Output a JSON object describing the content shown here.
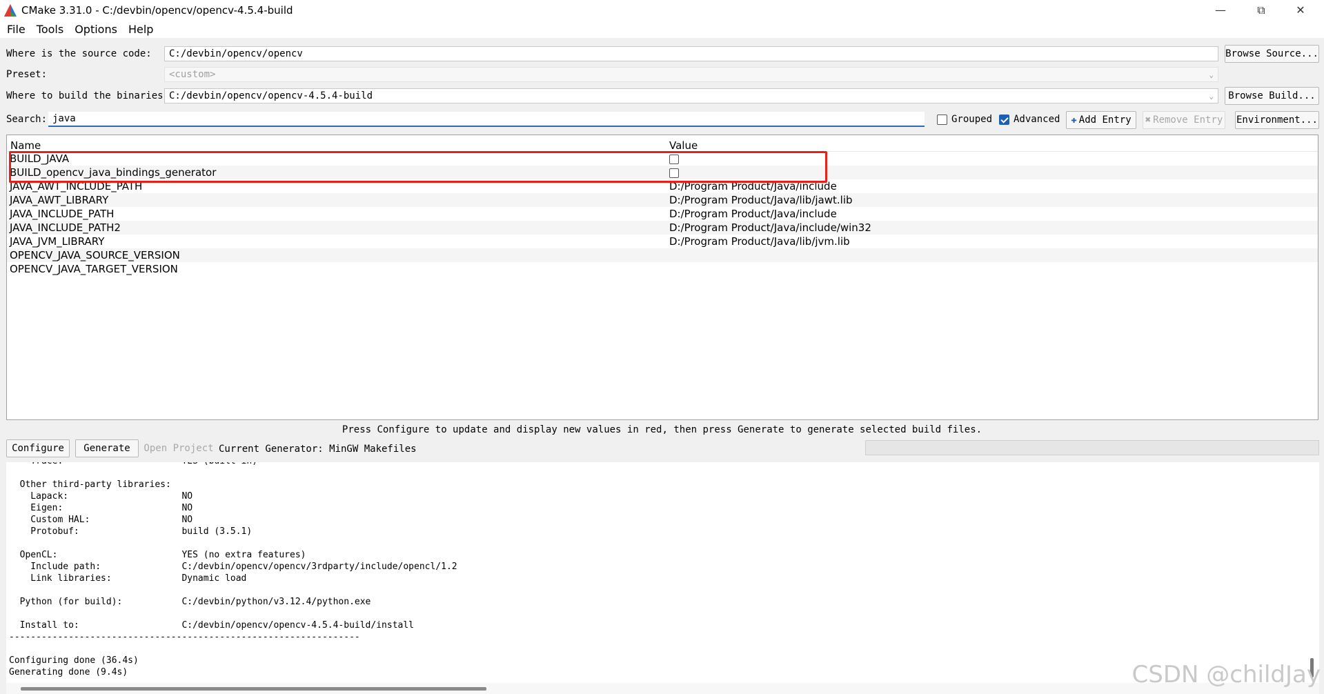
{
  "window": {
    "title": "CMake 3.31.0 - C:/devbin/opencv/opencv-4.5.4-build",
    "minimize": "—",
    "restore": "⧉",
    "close": "✕"
  },
  "menu": {
    "file": "File",
    "tools": "Tools",
    "options": "Options",
    "help": "Help"
  },
  "source": {
    "label": "Where is the source code:",
    "value": "C:/devbin/opencv/opencv",
    "browse": "Browse Source..."
  },
  "preset": {
    "label": "Preset:",
    "value": "<custom>"
  },
  "build": {
    "label": "Where to build the binaries:",
    "value": "C:/devbin/opencv/opencv-4.5.4-build",
    "browse": "Browse Build..."
  },
  "search": {
    "label": "Search:",
    "value": "java",
    "grouped_label": "Grouped",
    "grouped_checked": false,
    "advanced_label": "Advanced",
    "advanced_checked": true,
    "add_entry": "Add Entry",
    "remove_entry": "Remove Entry",
    "environment": "Environment..."
  },
  "table": {
    "col_name": "Name",
    "col_value": "Value",
    "rows": [
      {
        "name": "BUILD_JAVA",
        "value": "",
        "checkbox": true
      },
      {
        "name": "BUILD_opencv_java_bindings_generator",
        "value": "",
        "checkbox": true
      },
      {
        "name": "JAVA_AWT_INCLUDE_PATH",
        "value": "D:/Program Product/Java/include"
      },
      {
        "name": "JAVA_AWT_LIBRARY",
        "value": "D:/Program Product/Java/lib/jawt.lib"
      },
      {
        "name": "JAVA_INCLUDE_PATH",
        "value": "D:/Program Product/Java/include"
      },
      {
        "name": "JAVA_INCLUDE_PATH2",
        "value": "D:/Program Product/Java/include/win32"
      },
      {
        "name": "JAVA_JVM_LIBRARY",
        "value": "D:/Program Product/Java/lib/jvm.lib"
      },
      {
        "name": "OPENCV_JAVA_SOURCE_VERSION",
        "value": ""
      },
      {
        "name": "OPENCV_JAVA_TARGET_VERSION",
        "value": ""
      }
    ]
  },
  "status_message": "Press Configure to update and display new values in red, then press Generate to generate selected build files.",
  "actions": {
    "configure": "Configure",
    "generate": "Generate",
    "open_project": "Open Project",
    "current_generator": "Current Generator: MinGW Makefiles"
  },
  "log_lines": [
    "    Trace:                      YES (built-in)",
    "",
    "  Other third-party libraries:",
    "    Lapack:                     NO",
    "    Eigen:                      NO",
    "    Custom HAL:                 NO",
    "    Protobuf:                   build (3.5.1)",
    "",
    "  OpenCL:                       YES (no extra features)",
    "    Include path:               C:/devbin/opencv/opencv/3rdparty/include/opencl/1.2",
    "    Link libraries:             Dynamic load",
    "",
    "  Python (for build):           C:/devbin/python/v3.12.4/python.exe",
    "",
    "  Install to:                   C:/devbin/opencv/opencv-4.5.4-build/install",
    "-----------------------------------------------------------------",
    "",
    "Configuring done (36.4s)",
    "Generating done (9.4s)"
  ],
  "watermark": "CSDN @childJay"
}
